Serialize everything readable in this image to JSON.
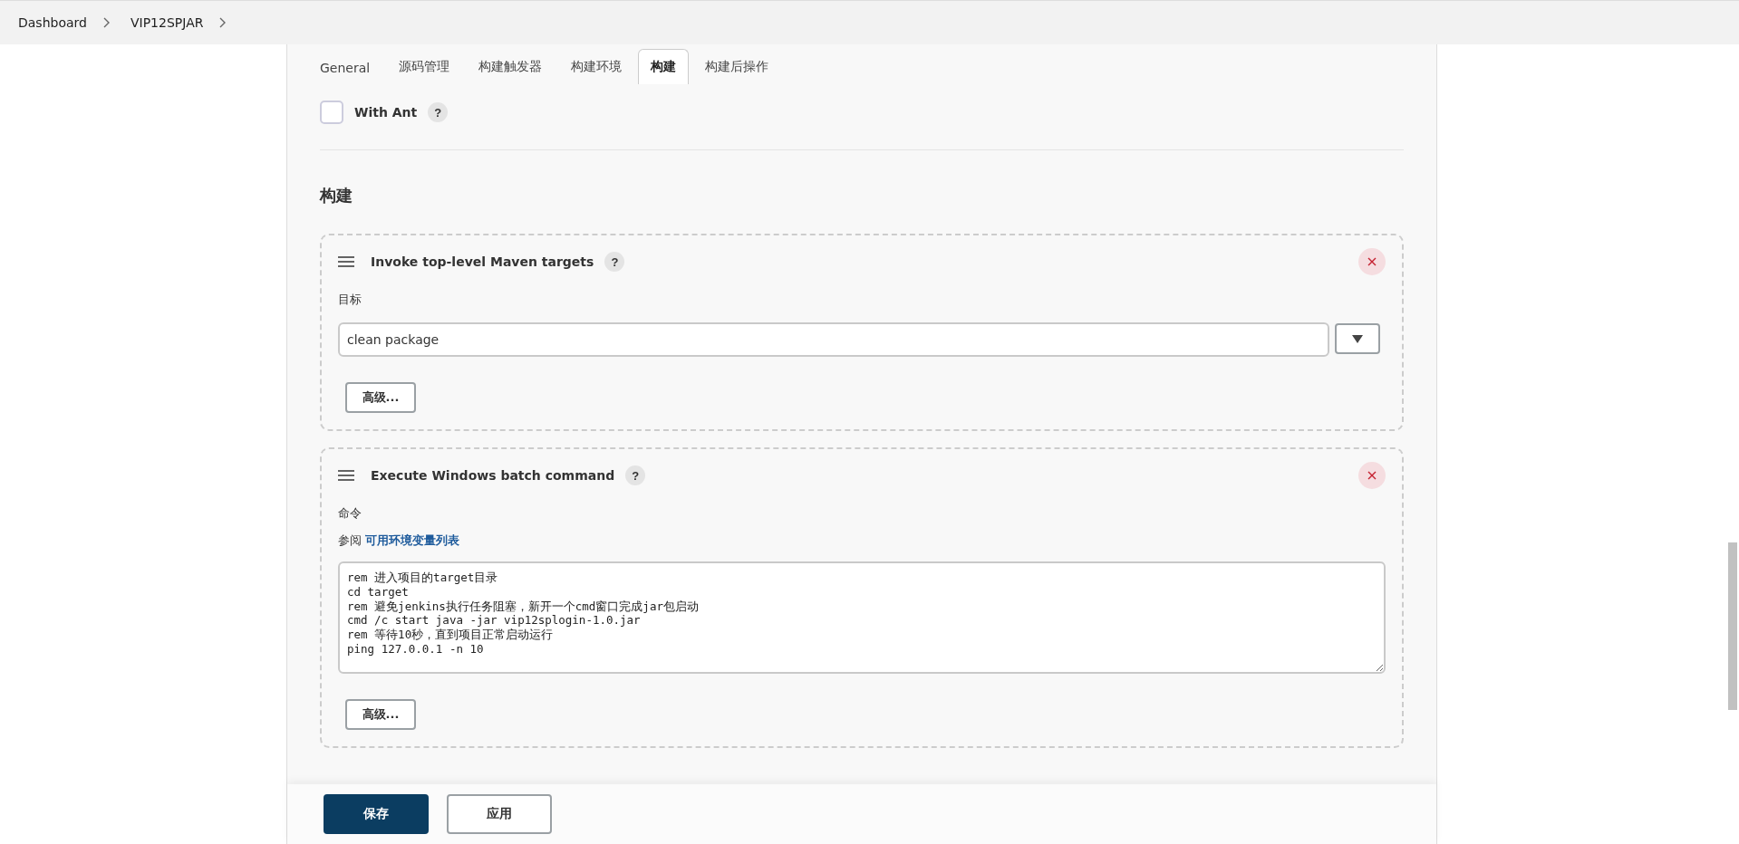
{
  "breadcrumbs": [
    "Dashboard",
    "VIP12SPJAR"
  ],
  "tabs": [
    {
      "label": "General",
      "selected": false
    },
    {
      "label": "源码管理",
      "selected": false
    },
    {
      "label": "构建触发器",
      "selected": false
    },
    {
      "label": "构建环境",
      "selected": false
    },
    {
      "label": "构建",
      "selected": true
    },
    {
      "label": "构建后操作",
      "selected": false
    }
  ],
  "with_ant": {
    "label": "With Ant",
    "checked": false,
    "help": "?"
  },
  "section_title": "构建",
  "steps": [
    {
      "kind": "maven",
      "title": "Invoke top-level Maven targets",
      "help": "?",
      "field_label": "目标",
      "value": "clean package",
      "advanced": "高级..."
    },
    {
      "kind": "batch",
      "title": "Execute Windows batch command",
      "help": "?",
      "field_label": "命令",
      "help_prefix": "参阅",
      "help_link": "可用环境变量列表",
      "value": "rem 进入项目的target目录\ncd target\nrem 避免jenkins执行任务阻塞，新开一个cmd窗口完成jar包启动\ncmd /c start java -jar vip12splogin-1.0.jar\nrem 等待10秒，直到项目正常启动运行\nping 127.0.0.1 -n 10",
      "advanced": "高级..."
    }
  ],
  "buttons": {
    "save": "保存",
    "apply": "应用"
  }
}
